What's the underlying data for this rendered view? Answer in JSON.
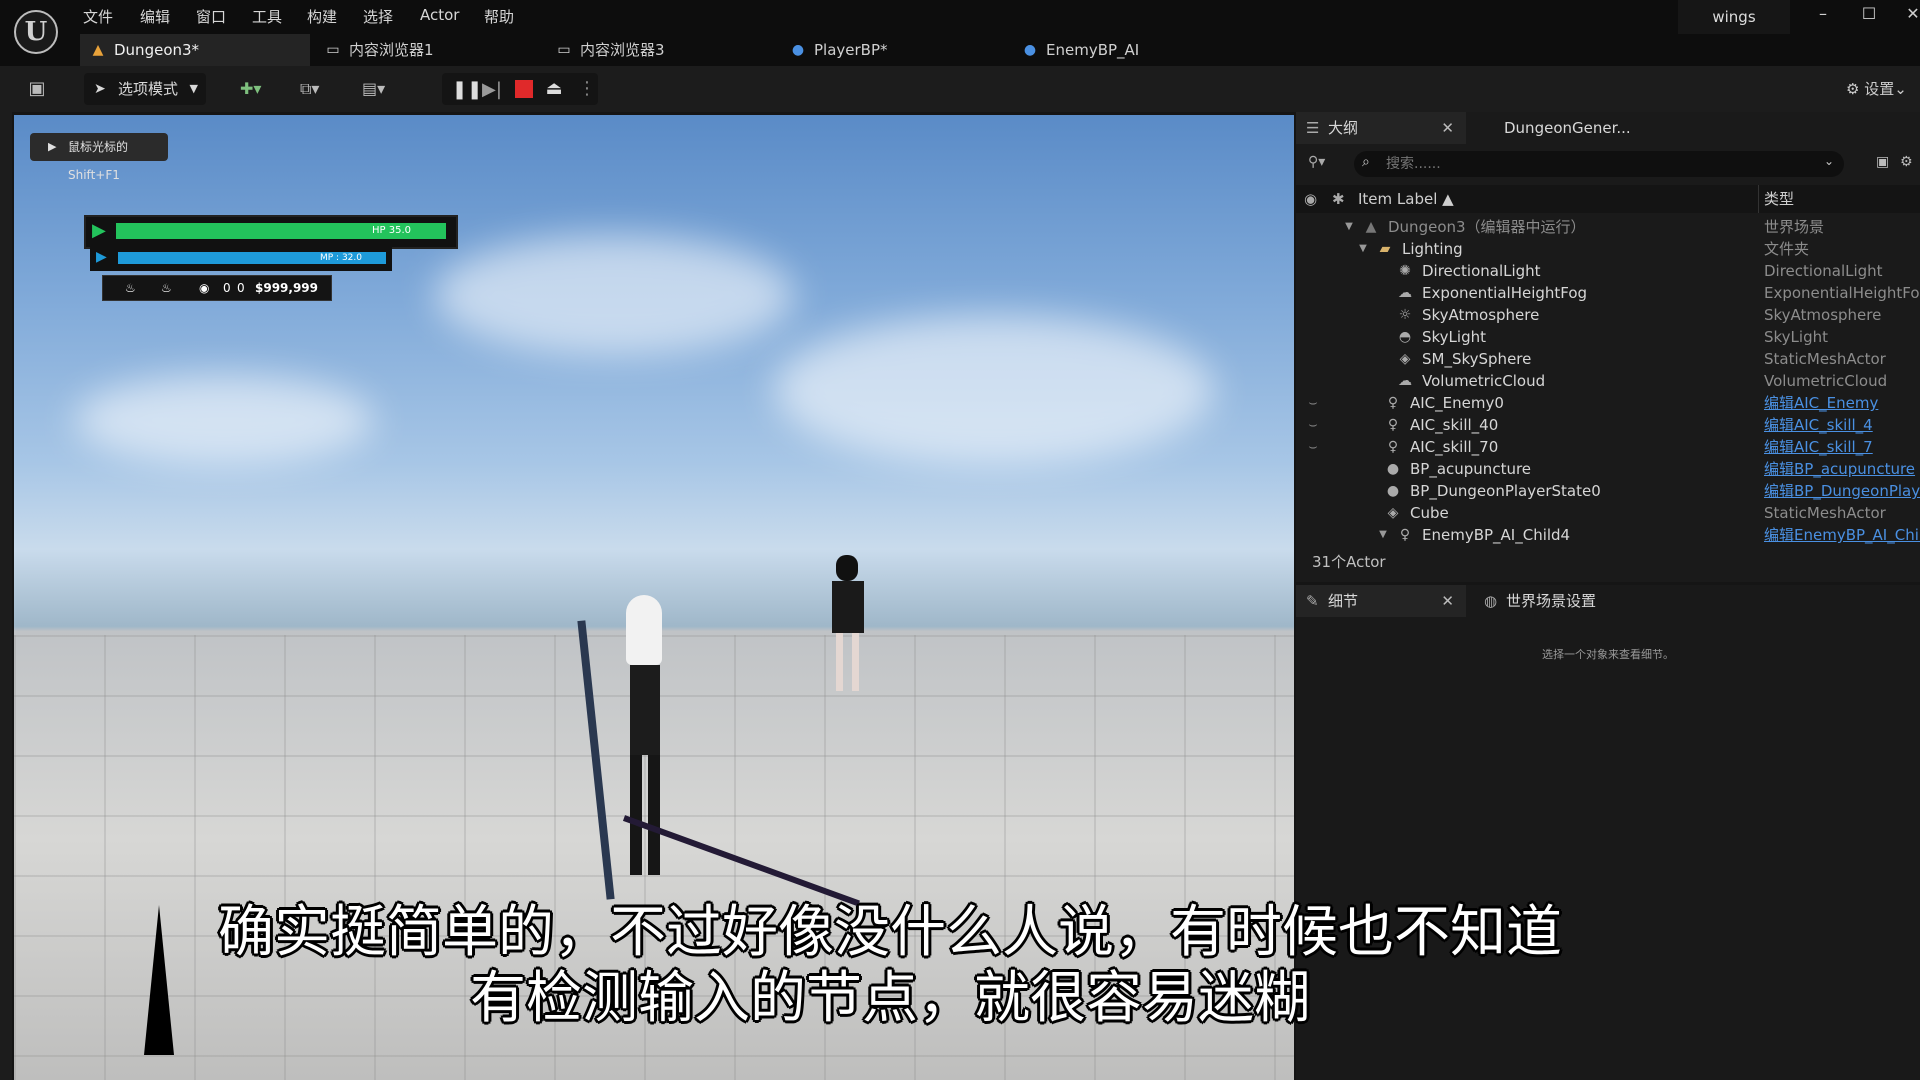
{
  "menubar": {
    "items": [
      "文件",
      "编辑",
      "窗口",
      "工具",
      "构建",
      "选择",
      "Actor",
      "帮助"
    ],
    "project": "wings"
  },
  "tabs": [
    {
      "label": "Dungeon3*",
      "icon": "level-icon",
      "active": true
    },
    {
      "label": "内容浏览器1",
      "icon": "folder-icon"
    },
    {
      "label": "内容浏览器3",
      "icon": "folder-icon"
    },
    {
      "label": "PlayerBP*",
      "icon": "pawn-icon"
    },
    {
      "label": "EnemyBP_AI",
      "icon": "pawn-icon"
    }
  ],
  "toolbar": {
    "mode_label": "选项模式",
    "settings_label": "设置"
  },
  "viewport": {
    "hint": "鼠标光标的Shift+F1",
    "hud": {
      "hp_text": "HP 35.0",
      "hp_fraction": 1.0,
      "mp_text": "MP : 32.0",
      "mp_fraction": 1.0,
      "count_a": "0",
      "count_b": "0",
      "money": "$999,999"
    },
    "subtitle_line1": "确实挺简单的，不过好像没什么人说，有时候也不知道",
    "subtitle_line2": "有检测输入的节点，就很容易迷糊"
  },
  "outliner": {
    "tab_label": "大纲",
    "tab2_label": "DungeonGener...",
    "search_placeholder": "搜索......",
    "col_label": "Item Label ▲",
    "col_type": "类型",
    "rows": [
      {
        "label": "Dungeon3（编辑器中运行）",
        "type": "世界场景",
        "link": false
      },
      {
        "label": "Lighting",
        "type": "文件夹",
        "link": false
      },
      {
        "label": "DirectionalLight",
        "type": "DirectionalLight",
        "link": false
      },
      {
        "label": "ExponentialHeightFog",
        "type": "ExponentialHeightFog",
        "link": false
      },
      {
        "label": "SkyAtmosphere",
        "type": "SkyAtmosphere",
        "link": false
      },
      {
        "label": "SkyLight",
        "type": "SkyLight",
        "link": false
      },
      {
        "label": "SM_SkySphere",
        "type": "StaticMeshActor",
        "link": false
      },
      {
        "label": "VolumetricCloud",
        "type": "VolumetricCloud",
        "link": false
      },
      {
        "label": "AIC_Enemy0",
        "type": "编辑AIC_Enemy",
        "link": true
      },
      {
        "label": "AIC_skill_40",
        "type": "编辑AIC_skill_4",
        "link": true
      },
      {
        "label": "AIC_skill_70",
        "type": "编辑AIC_skill_7",
        "link": true
      },
      {
        "label": "BP_acupuncture",
        "type": "编辑BP_acupuncture",
        "link": true
      },
      {
        "label": "BP_DungeonPlayerState0",
        "type": "编辑BP_DungeonPlaye",
        "link": true
      },
      {
        "label": "Cube",
        "type": "StaticMeshActor",
        "link": false
      },
      {
        "label": "EnemyBP_AI_Child4",
        "type": "编辑EnemyBP_AI_Chil",
        "link": true
      }
    ],
    "actor_count": "31个Actor"
  },
  "details": {
    "tab_label": "细节",
    "tab2_label": "世界场景设置",
    "empty_text": "选择一个对象来查看细节。"
  }
}
